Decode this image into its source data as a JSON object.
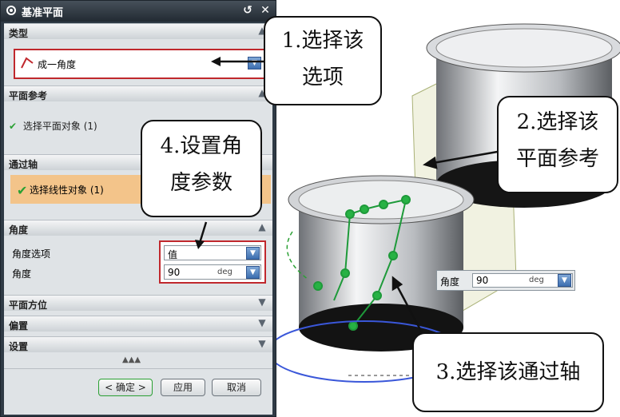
{
  "dialog": {
    "title": "基准平面",
    "title_buttons": {
      "reset": "↺",
      "close": "✕"
    },
    "type_section": {
      "label": "类型",
      "selected": "成一角度"
    },
    "plane_ref_section": {
      "label": "平面参考",
      "item": "选择平面对象 (1)"
    },
    "through_axis_section": {
      "label": "通过轴",
      "item": "选择线性对象 (1)"
    },
    "angle_section": {
      "label": "角度",
      "option_label": "角度选项",
      "option_value": "值",
      "angle_label": "角度",
      "angle_value": "90",
      "angle_unit": "deg"
    },
    "collapsed_sections": [
      "平面方位",
      "偏置",
      "设置"
    ],
    "more_indicator": "▲▲▲",
    "buttons": {
      "ok": "< 确定 >",
      "apply": "应用",
      "cancel": "取消"
    }
  },
  "viewport": {
    "angle_input": {
      "label": "角度",
      "value": "90",
      "unit": "deg"
    }
  },
  "callouts": {
    "c1": [
      "1.选择该",
      "选项"
    ],
    "c2": [
      "2.选择该",
      "平面参考"
    ],
    "c3": "3.选择该通过轴",
    "c4": [
      "4.设置角",
      "度参数"
    ]
  }
}
